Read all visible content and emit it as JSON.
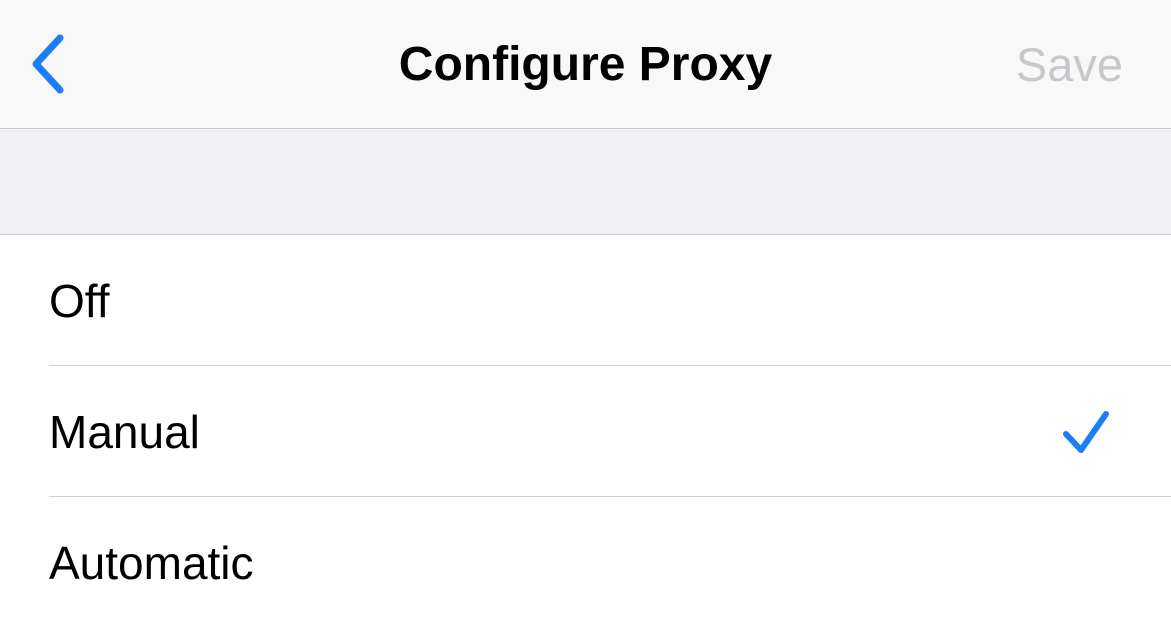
{
  "nav": {
    "back_icon": "chevron-left-icon",
    "title": "Configure Proxy",
    "save_label": "Save"
  },
  "options": [
    {
      "label": "Off",
      "selected": false
    },
    {
      "label": "Manual",
      "selected": true
    },
    {
      "label": "Automatic",
      "selected": false
    }
  ],
  "colors": {
    "accent": "#1a7ff5",
    "disabled_text": "#c8c8cc",
    "grouped_background": "#f0f0f5",
    "nav_background": "#f8f8f9",
    "separator": "#d1d1d6"
  }
}
